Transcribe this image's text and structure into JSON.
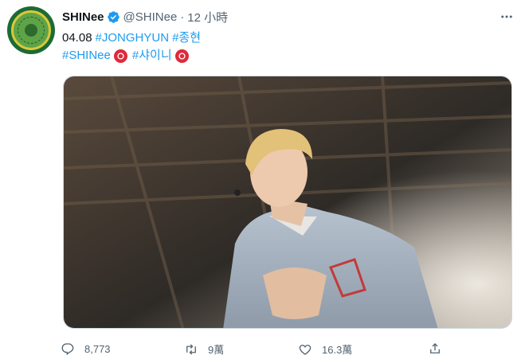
{
  "tweet": {
    "author_name": "SHINee",
    "handle": "@SHINee",
    "separator": "·",
    "time": "12 小時",
    "line1_text": "04.08",
    "line1_tags": [
      "#JONGHYUN",
      "#종현"
    ],
    "line2_tags": [
      "#SHINee",
      "#샤이니"
    ]
  },
  "actions": {
    "reply_count": "8,773",
    "retweet_count": "9萬",
    "like_count": "16.3萬"
  },
  "icons": {
    "verified": "verified-badge-icon",
    "more": "more-options-icon",
    "reply": "reply-icon",
    "retweet": "retweet-icon",
    "like": "like-icon",
    "share": "share-icon"
  },
  "colors": {
    "link": "#1d9bf0",
    "secondary_text": "#536471",
    "primary_text": "#0f1419",
    "badge_red": "#e0293a"
  }
}
